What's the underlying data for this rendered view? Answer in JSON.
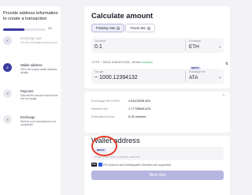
{
  "sidebar": {
    "title": "Provide address information to create a transaction",
    "progress": {
      "fraction": 0.5,
      "label": "2/4"
    },
    "steps": [
      {
        "number": "✓",
        "title": "Exchange pair",
        "description": "Set the exchange currency pair",
        "state": "done"
      },
      {
        "number": "2",
        "title": "Wallet address",
        "description": "Fill in the crypto wallet address details",
        "state": "active"
      },
      {
        "number": "3",
        "title": "Payment",
        "description": "Deposit the amount required for the exchange",
        "state": "pending"
      },
      {
        "number": "4",
        "title": "Exchange",
        "description": "Wait for your transaction to be completed",
        "state": "pending"
      }
    ]
  },
  "calculate": {
    "title": "Calculate amount",
    "tabs": [
      {
        "label": "Floating rate",
        "active": true
      },
      {
        "label": "Fixed rate",
        "active": false
      }
    ],
    "send": {
      "label": "You send",
      "value": "0.1",
      "currency_label": "Exchange",
      "currency": "ETH"
    },
    "rate_text": "1 ETH ~ 10514.12351672 ATA · All fees",
    "rate_included": "included",
    "get": {
      "label": "You get",
      "value": "~ 1000.12394132",
      "currency_label": "Exchange fee",
      "currency": "ATA",
      "network_badge": "BEP20"
    }
  },
  "summary": {
    "rows": [
      {
        "label": "Exchange fee 0.25%",
        "value": "2.81103008 ATA"
      },
      {
        "label": "Network fee",
        "value": "1.77705808 ATA"
      },
      {
        "label": "Estimated arrival",
        "value": "5-30 minutes"
      }
    ]
  },
  "wallet": {
    "title": "Wallet address",
    "badge": "BEP20",
    "placeholder": "Enter your ATA recipient address",
    "support_text": "FIO protocol and Unstoppable Domains are supported",
    "fio_logo": "FIO",
    "next_label": "Next step"
  },
  "colors": {
    "accent": "#3b3ba0",
    "highlight": "#e53a2a",
    "included": "#2bb36b",
    "button": "#b5b5e0"
  }
}
